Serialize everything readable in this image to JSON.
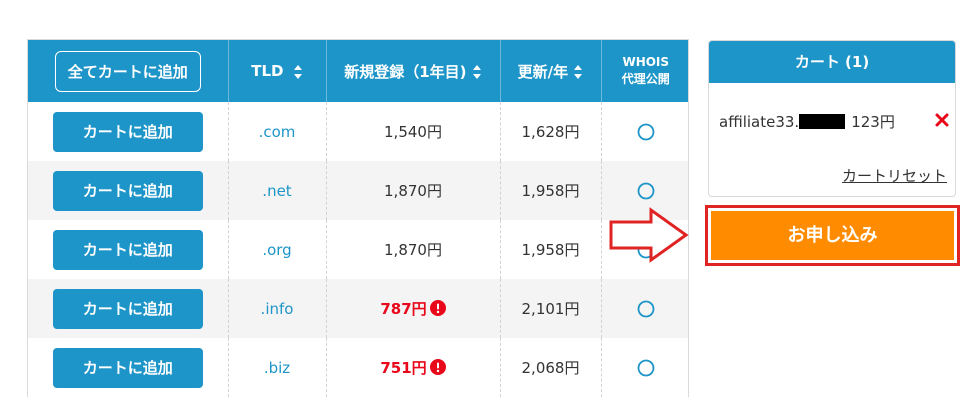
{
  "colors": {
    "primary": "#1e95c8",
    "sale_red": "#e8081a",
    "apply_orange": "#ff8c00",
    "highlight_red": "#e02424"
  },
  "table": {
    "add_all_label": "全てカートに追加",
    "headers": {
      "tld": "TLD",
      "new_registration": "新規登録（1年目)",
      "renewal": "更新/年",
      "whois_line1": "WHOIS",
      "whois_line2": "代理公開"
    },
    "add_button_label": "カートに追加",
    "rows": [
      {
        "tld": ".com",
        "new_price": "1,540円",
        "renewal": "1,628円",
        "sale": false,
        "whois_icon": "circle-icon"
      },
      {
        "tld": ".net",
        "new_price": "1,870円",
        "renewal": "1,958円",
        "sale": false,
        "whois_icon": "circle-icon"
      },
      {
        "tld": ".org",
        "new_price": "1,870円",
        "renewal": "1,958円",
        "sale": false,
        "whois_icon": "circle-icon"
      },
      {
        "tld": ".info",
        "new_price": "787円",
        "renewal": "2,101円",
        "sale": true,
        "whois_icon": "circle-icon"
      },
      {
        "tld": ".biz",
        "new_price": "751円",
        "renewal": "2,068円",
        "sale": true,
        "whois_icon": "circle-icon"
      }
    ]
  },
  "cart": {
    "title": "カート (1)",
    "item_domain": "affiliate33.",
    "item_price": "123円",
    "reset_label": "カートリセット"
  },
  "apply_button_label": "お申し込み"
}
